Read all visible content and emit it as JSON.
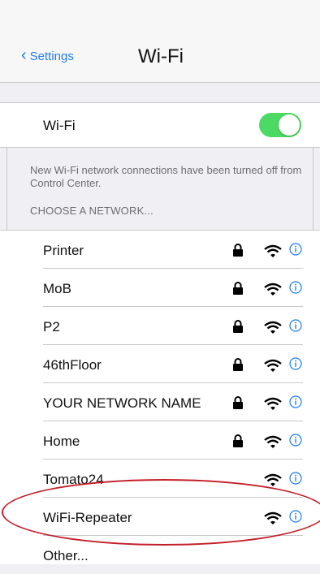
{
  "nav": {
    "back_label": "Settings",
    "title": "Wi-Fi"
  },
  "wifi_toggle": {
    "label": "Wi-Fi",
    "state": "on",
    "color": "#4cd964"
  },
  "note": "New Wi-Fi network connections have been turned off from Control Center.",
  "section_header": "CHOOSE A NETWORK...",
  "networks": [
    {
      "name": "Printer",
      "locked": true
    },
    {
      "name": "MoB",
      "locked": true
    },
    {
      "name": "P2",
      "locked": true
    },
    {
      "name": "46thFloor",
      "locked": true
    },
    {
      "name": "YOUR NETWORK NAME",
      "locked": true
    },
    {
      "name": "Home",
      "locked": true
    },
    {
      "name": "Tomato24",
      "locked": false
    },
    {
      "name": "WiFi-Repeater",
      "locked": false
    }
  ],
  "other_label": "Other...",
  "colors": {
    "accent": "#1e7cf0",
    "highlight_ring": "#c41e28"
  }
}
